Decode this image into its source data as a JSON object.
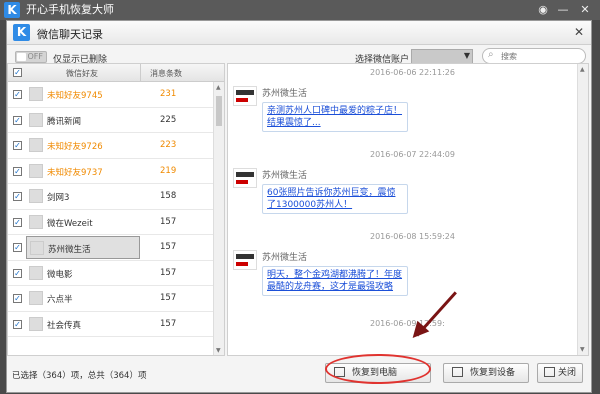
{
  "outer": {
    "title": "开心手机恢复大师",
    "logo": "K",
    "wechat_icon": "wechat-icon",
    "controls": [
      "—",
      "✕"
    ]
  },
  "dialog": {
    "title": "微信聊天记录",
    "logo": "K",
    "close": "✕"
  },
  "toolbar": {
    "toggle_state": "OFF",
    "toggle_label": "仅显示已删除",
    "account_label": "选择微信账户",
    "search_placeholder": "搜索"
  },
  "list": {
    "headers": {
      "friend": "微信好友",
      "count": "消息条数"
    },
    "rows": [
      {
        "name": "未知好友9745",
        "count": "231",
        "unknown": true,
        "selected": false
      },
      {
        "name": "腾讯新闻",
        "count": "225",
        "unknown": false,
        "selected": false
      },
      {
        "name": "未知好友9726",
        "count": "223",
        "unknown": true,
        "selected": false
      },
      {
        "name": "未知好友9737",
        "count": "219",
        "unknown": true,
        "selected": false
      },
      {
        "name": "剑网3",
        "count": "158",
        "unknown": false,
        "selected": false
      },
      {
        "name": "微在Wezeit",
        "count": "157",
        "unknown": false,
        "selected": false
      },
      {
        "name": "苏州微生活",
        "count": "157",
        "unknown": false,
        "selected": true
      },
      {
        "name": "微电影",
        "count": "157",
        "unknown": false,
        "selected": false
      },
      {
        "name": "六点半",
        "count": "157",
        "unknown": false,
        "selected": false
      },
      {
        "name": "社会传真",
        "count": "157",
        "unknown": false,
        "selected": false
      }
    ]
  },
  "chat": {
    "messages": [
      {
        "time": "2016-06-06 22:11:26",
        "sender": "苏州微生活",
        "text": "亲测苏州人口碑中最爱的粽子店！结果震惊了..."
      },
      {
        "time": "2016-06-07 22:44:09",
        "sender": "苏州微生活",
        "text": "60张照片告诉你苏州巨变，震惊了1300000苏州人！"
      },
      {
        "time": "2016-06-08 15:59:24",
        "sender": "苏州微生活",
        "text": "明天，整个金鸡湖都沸腾了！年度最酷的龙舟赛，这才是最强攻略"
      },
      {
        "time": "2016-06-09 12:59:",
        "sender": "",
        "text": ""
      }
    ]
  },
  "footer": {
    "status": "已选择（364）项，总共（364）项",
    "restore_pc": "恢复到电脑",
    "restore_device": "恢复到设备",
    "close": "关闭"
  },
  "colors": {
    "accent": "#2f8be6",
    "unknown_friend": "#f08a00",
    "link": "#1b4fd8",
    "annotation": "#e0332f"
  }
}
